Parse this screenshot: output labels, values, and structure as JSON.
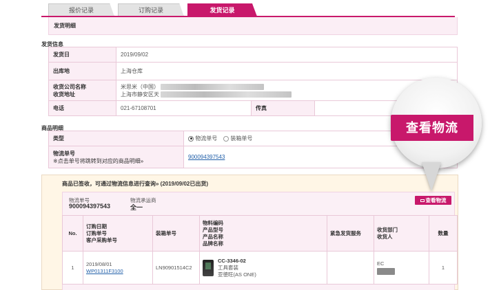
{
  "tabs": [
    {
      "label": "报价记录",
      "active": false
    },
    {
      "label": "订购记录",
      "active": false
    },
    {
      "label": "发货记录",
      "active": true
    }
  ],
  "section_title": "发货明细",
  "shipping_info": {
    "heading": "发货信息",
    "ship_date_label": "发货日",
    "ship_date": "2019/09/02",
    "warehouse_label": "出库地",
    "warehouse": "上海仓库",
    "receiver_label_1": "收货公司名称",
    "receiver_label_2": "收货地址",
    "receiver_company": "米思米（中国）",
    "receiver_address": "上海市静安区天",
    "phone_label": "电话",
    "phone": "021-67108701",
    "fax_label": "传真",
    "fax": ""
  },
  "product_detail": {
    "heading": "商品明细",
    "type_label": "类型",
    "option_tracking": "物流单号",
    "option_box": "装箱单号",
    "tracking_label": "物流单号",
    "tracking_hint": "※点击单号将跳转到对应的商品明细»",
    "tracking_link": "900094397543"
  },
  "notice": {
    "title": "商品已签收，可通过物流信息进行查询» (2019/09/02已出货)",
    "tracking_no_label": "物流单号",
    "tracking_no": "900094397543",
    "carrier_label": "物流承运商",
    "carrier": "全一",
    "view_button": "查看物流"
  },
  "grid": {
    "headers": {
      "no": "No.",
      "order": [
        "订购日期",
        "订购单号",
        "客户采购单号"
      ],
      "box": "装箱单号",
      "product": [
        "物料编码",
        "产品型号",
        "产品名称",
        "品牌名称"
      ],
      "urgent": "紧急发货服务",
      "dept": [
        "收货部门",
        "收货人"
      ],
      "qty": "数量"
    },
    "row": {
      "no": "1",
      "order_date": "2019/08/01",
      "order_no": "WP01311F3100",
      "box_no": "LN90901514C2",
      "model": "CC-3346-02",
      "name": "工具套装",
      "brand": "亚徳旺(AS ONE)",
      "urgent": "",
      "dept": "EC",
      "qty": "1"
    }
  },
  "callout": {
    "text": "查看物流"
  },
  "colors": {
    "accent": "#c8186b",
    "pink_bg": "#fbeef5",
    "notice_bg": "#fff6e6"
  }
}
